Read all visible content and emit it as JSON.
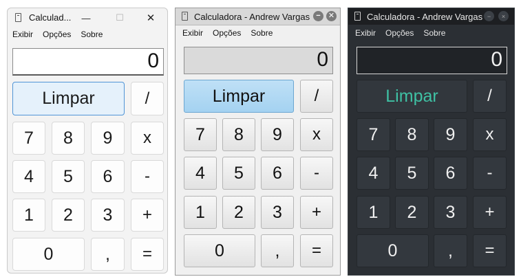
{
  "windows": [
    {
      "title": "Calculad...",
      "menu": [
        "Exibir",
        "Opções",
        "Sobre"
      ],
      "display": "0",
      "controls": {
        "minimize": "—",
        "maximize": "☐",
        "close": "✕"
      },
      "keys": {
        "clear": "Limpar",
        "divide": "/",
        "seven": "7",
        "eight": "8",
        "nine": "9",
        "multiply": "x",
        "four": "4",
        "five": "5",
        "six": "6",
        "minus": "-",
        "one": "1",
        "two": "2",
        "three": "3",
        "plus": "+",
        "zero": "0",
        "comma": ",",
        "equals": "="
      }
    },
    {
      "title": "Calculadora - Andrew Vargas",
      "menu": [
        "Exibir",
        "Opções",
        "Sobre"
      ],
      "display": "0",
      "controls": {
        "minimize": "−",
        "close": "✕"
      },
      "keys": {
        "clear": "Limpar",
        "divide": "/",
        "seven": "7",
        "eight": "8",
        "nine": "9",
        "multiply": "x",
        "four": "4",
        "five": "5",
        "six": "6",
        "minus": "-",
        "one": "1",
        "two": "2",
        "three": "3",
        "plus": "+",
        "zero": "0",
        "comma": ",",
        "equals": "="
      }
    },
    {
      "title": "Calculadora - Andrew Vargas",
      "menu": [
        "Exibir",
        "Opções",
        "Sobre"
      ],
      "display": "0",
      "controls": {
        "minimize": "−",
        "close": "×"
      },
      "keys": {
        "clear": "Limpar",
        "divide": "/",
        "seven": "7",
        "eight": "8",
        "nine": "9",
        "multiply": "x",
        "four": "4",
        "five": "5",
        "six": "6",
        "minus": "-",
        "one": "1",
        "two": "2",
        "three": "3",
        "plus": "+",
        "zero": "0",
        "comma": ",",
        "equals": "="
      }
    }
  ],
  "colors": {
    "light_accent": "#e5f1fb",
    "classic_accent": "#a4d2f1",
    "dark_accent_text": "#3fc1a4",
    "dark_background": "#2b2f34"
  }
}
